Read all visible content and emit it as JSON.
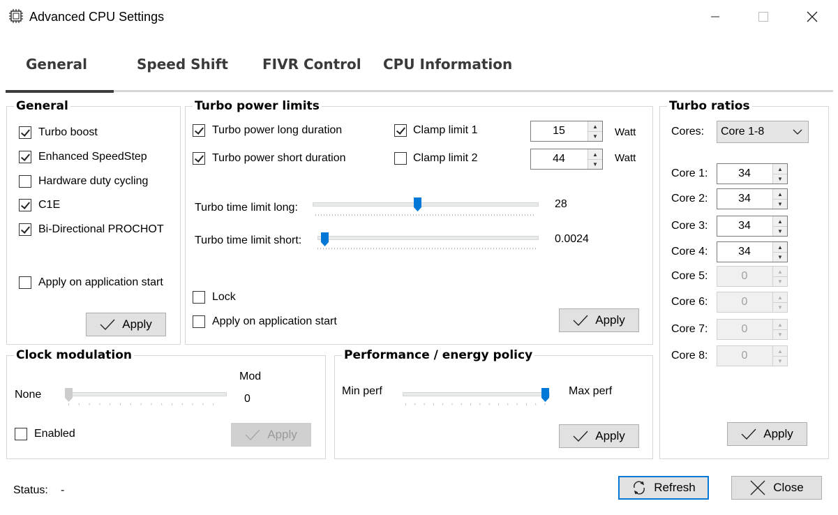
{
  "window": {
    "title": "Advanced CPU Settings"
  },
  "tabs": [
    "General",
    "Speed Shift",
    "FIVR Control",
    "CPU Information"
  ],
  "general": {
    "title": "General",
    "options": [
      {
        "label": "Turbo boost",
        "checked": true
      },
      {
        "label": "Enhanced SpeedStep",
        "checked": true
      },
      {
        "label": "Hardware duty cycling",
        "checked": false
      },
      {
        "label": "C1E",
        "checked": true
      },
      {
        "label": "Bi-Directional PROCHOT",
        "checked": true
      }
    ],
    "apply_on_start": "Apply on application start",
    "apply": "Apply"
  },
  "turbo_power": {
    "title": "Turbo power limits",
    "long_duration": "Turbo power long duration",
    "short_duration": "Turbo power short duration",
    "clamp1": "Clamp limit 1",
    "clamp2": "Clamp limit 2",
    "limit1": "15",
    "limit2": "44",
    "unit": "Watt",
    "time_long_label": "Turbo time limit long:",
    "time_long_value": "28",
    "time_short_label": "Turbo time limit short:",
    "time_short_value": "0.0024",
    "lock": "Lock",
    "apply_on_start": "Apply on application start",
    "apply": "Apply"
  },
  "turbo_ratios": {
    "title": "Turbo ratios",
    "cores_label": "Cores:",
    "cores_selected": "Core 1-8",
    "cores": [
      {
        "label": "Core 1:",
        "value": "34",
        "enabled": true
      },
      {
        "label": "Core 2:",
        "value": "34",
        "enabled": true
      },
      {
        "label": "Core 3:",
        "value": "34",
        "enabled": true
      },
      {
        "label": "Core 4:",
        "value": "34",
        "enabled": true
      },
      {
        "label": "Core 5:",
        "value": "0",
        "enabled": false
      },
      {
        "label": "Core 6:",
        "value": "0",
        "enabled": false
      },
      {
        "label": "Core 7:",
        "value": "0",
        "enabled": false
      },
      {
        "label": "Core 8:",
        "value": "0",
        "enabled": false
      }
    ],
    "apply": "Apply"
  },
  "clock": {
    "title": "Clock modulation",
    "none": "None",
    "mod": "Mod",
    "value": "0",
    "enabled": "Enabled",
    "apply": "Apply"
  },
  "perf": {
    "title": "Performance / energy policy",
    "min": "Min perf",
    "max": "Max perf",
    "apply": "Apply"
  },
  "status": {
    "label": "Status:",
    "value": "-"
  },
  "footer": {
    "refresh": "Refresh",
    "close": "Close"
  }
}
